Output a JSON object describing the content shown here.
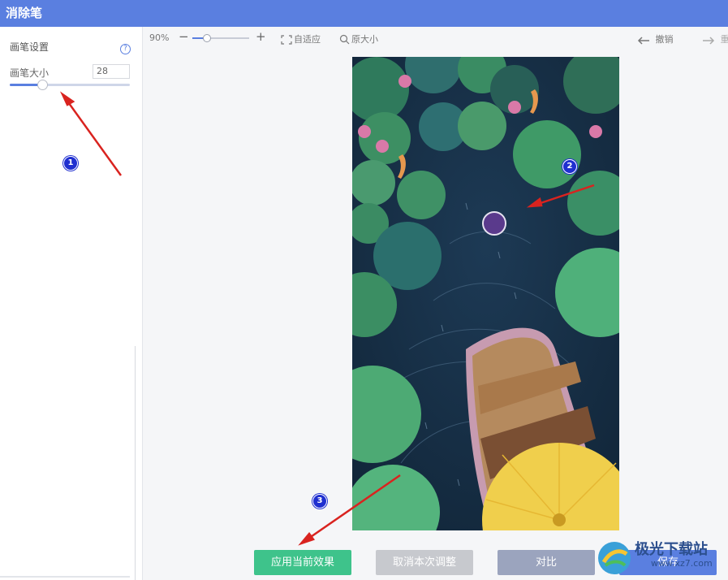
{
  "window": {
    "title": "消除笔"
  },
  "sidebar": {
    "section_title": "画笔设置",
    "help_icon": "help-circle-icon",
    "brush_size_label": "画笔大小",
    "brush_size_value": "28",
    "brush_slider_fraction": 0.27
  },
  "toolbar": {
    "zoom_value": "90%",
    "zoom_minus": "−",
    "zoom_plus": "+",
    "zoom_slider_fraction": 0.24,
    "fit_label": "自适应",
    "original_size_label": "原大小",
    "undo_label": "撤销",
    "redo_label": "重"
  },
  "annotations": {
    "step1": "1",
    "step2": "2",
    "step3": "3"
  },
  "buttons": {
    "apply": "应用当前效果",
    "cancel": "取消本次调整",
    "compare": "对比",
    "save": "保存"
  },
  "watermark": {
    "text": "极光下载站",
    "url": "www.xz7.com"
  },
  "colors": {
    "titlebar": "#5a7fe0",
    "apply": "#3ec38b",
    "arrow": "#d9231f",
    "annotation": "#1f2fd0"
  }
}
